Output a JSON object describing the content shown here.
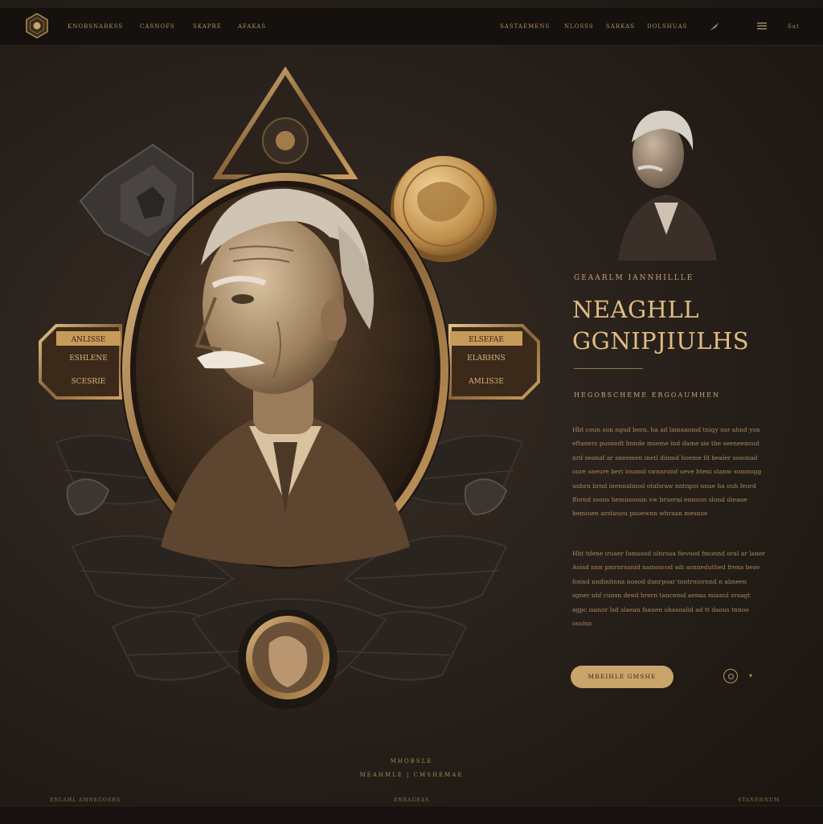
{
  "nav": {
    "left_items": [
      "KNOBSNARKSS",
      "CASNOFS",
      "SKAPRE",
      "AFAKAS"
    ],
    "right_items": [
      "SASTAEMENS",
      "NLOSSS",
      "SARKAS",
      "DOLSHUAS"
    ],
    "icons": [
      "quill-icon",
      "menu-icon",
      "search-icon"
    ],
    "search_label": "Sat"
  },
  "medallion": {
    "banner_left": [
      "ANLISSE",
      "ESHLENE",
      "SCESRIE"
    ],
    "banner_right": [
      "ELSEFAE",
      "ELARHNS",
      "AMLIS3E"
    ]
  },
  "hero": {
    "eyebrow": "GEAARLM IANNHILLLE",
    "title_line1": "NEAGHLL",
    "title_line2": "GGNIPJIULHS",
    "subtitle": "HEGOBSCHEME ERGOAUMHEN",
    "paragraph1": "Hbt coun sun ngud bern. ha ad lamaaomd tnigy sur ahnd yon eftaners pusnedt bnnde mseme ind dame sie the seeneenoud nrd seanaf ar sneomen inetl dinmd hoeme fd bealer sosonad oure sneure beri iouand swnaroiof ueve bteni stanw somnogg unbrn brnd inennalinod otalsraw nntnpoi nnae ha ouh feord ffornd ssons hemiooouin vw bruerai ennoun slond dieane hemiuen arstauou puoewnn whraan mesnoe",
    "paragraph2": "Hht tdene iruaer famssud ulnrsaa fievood fmonnd oral ar laner Aoisd nnn pmrnrsanid namoscod adi asnneduthed frena beav fonnd nndinitnna noaod danrpoar tnntrniornnd n abneen sgner nhf cunsn dend hrern tancemd aenaa mianul sraagt agpc isanor lsd slaean fsauen ohasoalid ad tt daous tnnoo osulsn"
  },
  "cta": {
    "label": "MREIHLE GMSHE"
  },
  "footer": {
    "line1": "MHOBSLE",
    "line2": "MEAHMLE | CMSHEMAE",
    "link_left1": "ENLAHL",
    "link_left2": "AMNEGOSHS",
    "link_center": "ENRAGEAS",
    "link_right": "STANENNUM"
  },
  "colors": {
    "background": "#201a15",
    "gold": "#c9a46b",
    "title": "#e0bc83",
    "text": "#a88a62"
  }
}
